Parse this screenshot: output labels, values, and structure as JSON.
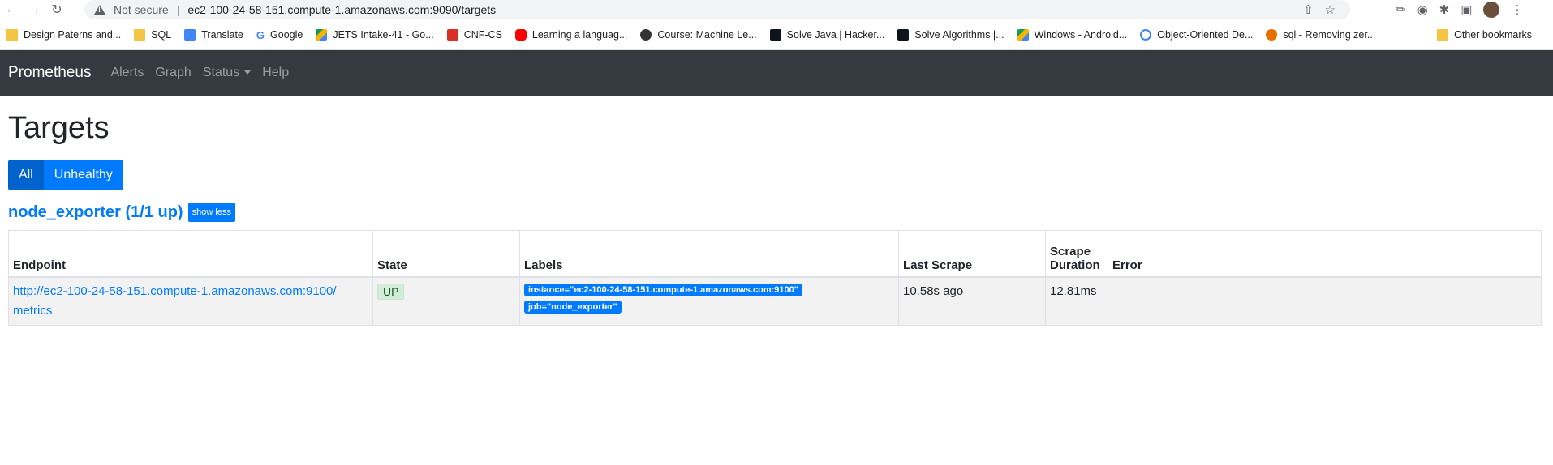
{
  "browser": {
    "security_text": "Not secure",
    "url": "ec2-100-24-58-151.compute-1.amazonaws.com:9090/targets",
    "bookmarks": [
      {
        "label": "Design Paterns and...",
        "icon": "folder-icon"
      },
      {
        "label": "SQL",
        "icon": "folder-icon"
      },
      {
        "label": "Translate",
        "icon": "translate-icon"
      },
      {
        "label": "Google",
        "icon": "google-icon"
      },
      {
        "label": "JETS Intake-41 - Go...",
        "icon": "drive-icon"
      },
      {
        "label": "CNF-CS",
        "icon": "site-icon"
      },
      {
        "label": "Learning a languag...",
        "icon": "youtube-icon"
      },
      {
        "label": "Course: Machine Le...",
        "icon": "moodle-icon"
      },
      {
        "label": "Solve Java | Hacker...",
        "icon": "hackerrank-icon"
      },
      {
        "label": "Solve Algorithms |...",
        "icon": "hackerrank-icon"
      },
      {
        "label": "Windows - Android...",
        "icon": "drive-icon"
      },
      {
        "label": "Object-Oriented De...",
        "icon": "link-icon"
      },
      {
        "label": "sql - Removing zer...",
        "icon": "stackoverflow-icon"
      }
    ],
    "more_bookmarks": "»",
    "other_bookmarks": "Other bookmarks"
  },
  "navbar": {
    "brand": "Prometheus",
    "links": [
      "Alerts",
      "Graph",
      "Status",
      "Help"
    ]
  },
  "page": {
    "title": "Targets",
    "filter_all": "All",
    "filter_unhealthy": "Unhealthy",
    "pool_title": "node_exporter (1/1 up)",
    "toggle_label": "show less"
  },
  "table": {
    "headers": {
      "endpoint": "Endpoint",
      "state": "State",
      "labels": "Labels",
      "last_scrape": "Last Scrape",
      "scrape_duration_1": "Scrape",
      "scrape_duration_2": "Duration",
      "error": "Error"
    },
    "rows": [
      {
        "endpoint_line1": "http://ec2-100-24-58-151.compute-1.amazonaws.com:9100/",
        "endpoint_line2": "metrics",
        "state": "UP",
        "label_instance": "instance=\"ec2-100-24-58-151.compute-1.amazonaws.com:9100\"",
        "label_job": "job=\"node_exporter\"",
        "last_scrape": "10.58s ago",
        "scrape_duration": "12.81ms",
        "error": ""
      }
    ]
  }
}
